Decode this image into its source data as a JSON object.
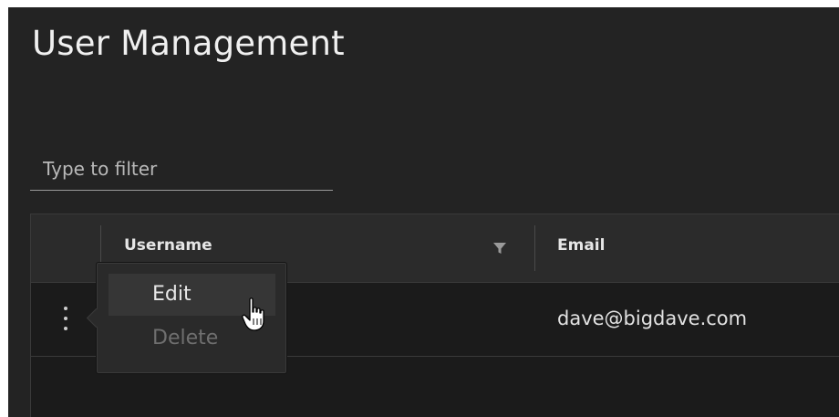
{
  "page": {
    "title": "User Management"
  },
  "filter": {
    "placeholder": "Type to filter",
    "value": ""
  },
  "table": {
    "columns": [
      {
        "label": "Username",
        "filter_icon": "filter-icon"
      },
      {
        "label": "Email"
      }
    ],
    "rows": [
      {
        "username": "",
        "email": "dave@bigdave.com"
      }
    ]
  },
  "row_menu": {
    "items": [
      {
        "label": "Edit",
        "enabled": true,
        "highlighted": true
      },
      {
        "label": "Delete",
        "enabled": false,
        "highlighted": false
      }
    ]
  },
  "icons": {
    "row_actions": "kebab-menu-icon",
    "column_filter": "filter-icon",
    "pointer": "hand-pointer-icon"
  },
  "colors": {
    "background": "#232323",
    "grid_background": "#1b1b1b",
    "header_background": "#2b2b2b",
    "menu_background": "#2a2a2a",
    "text_primary": "#e6e6e6",
    "text_disabled": "#6f6f6f"
  }
}
